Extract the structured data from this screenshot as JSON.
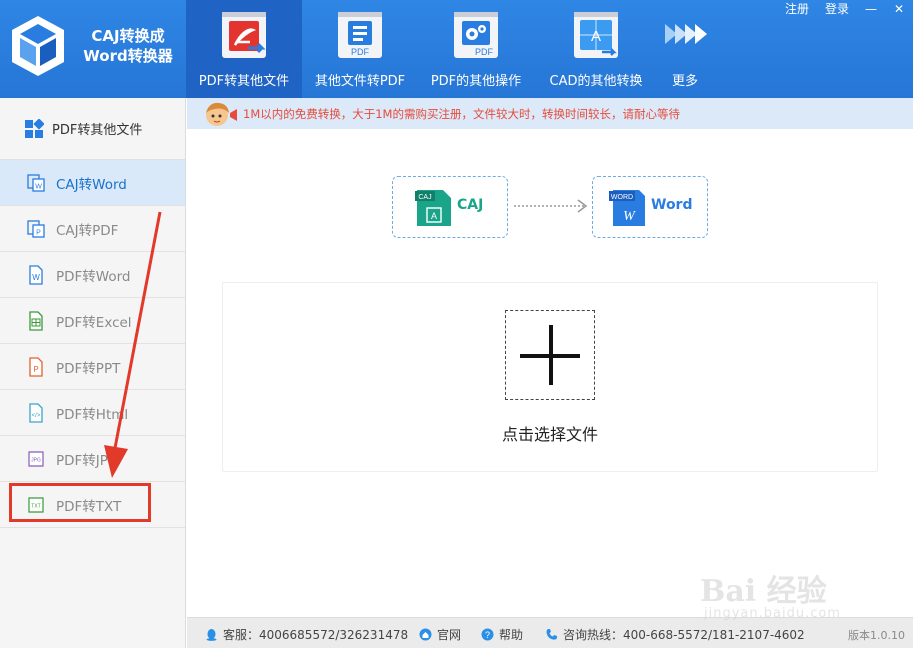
{
  "app": {
    "title_line1": "CAJ转换成",
    "title_line2": "Word转换器"
  },
  "top_links": {
    "register": "注册",
    "login": "登录"
  },
  "nav_tabs": [
    {
      "label": "PDF转其他文件",
      "icon": "pdf-acrobat-icon",
      "active": true
    },
    {
      "label": "其他文件转PDF",
      "icon": "file-to-pdf-icon",
      "active": false
    },
    {
      "label": "PDF的其他操作",
      "icon": "pdf-gear-icon",
      "active": false
    },
    {
      "label": "CAD的其他转换",
      "icon": "cad-icon",
      "active": false
    },
    {
      "label": "更多",
      "icon": "more-arrows-icon",
      "active": false
    }
  ],
  "sidebar": {
    "header": "PDF转其他文件",
    "items": [
      {
        "label": "CAJ转Word",
        "icon": "caj-word-icon",
        "active": true
      },
      {
        "label": "CAJ转PDF",
        "icon": "caj-pdf-icon",
        "active": false
      },
      {
        "label": "PDF转Word",
        "icon": "word-file-icon",
        "active": false
      },
      {
        "label": "PDF转Excel",
        "icon": "excel-file-icon",
        "active": false
      },
      {
        "label": "PDF转PPT",
        "icon": "ppt-file-icon",
        "active": false
      },
      {
        "label": "PDF转Html",
        "icon": "html-file-icon",
        "active": false
      },
      {
        "label": "PDF转JPG",
        "icon": "jpg-file-icon",
        "active": false
      },
      {
        "label": "PDF转TXT",
        "icon": "txt-file-icon",
        "active": false
      }
    ]
  },
  "notice": "1M以内的免费转换，大于1M的需购买注册，文件较大时，转换时间较长，请耐心等待",
  "conversion": {
    "source_badge": "CAJ",
    "source_label": "CAJ",
    "target_badge": "WORD",
    "target_label": "Word"
  },
  "drop_area": {
    "label": "点击选择文件"
  },
  "footer": {
    "service": "客服：4006685572/326231478",
    "website": "官网",
    "help": "帮助",
    "hotline": "咨询热线：400-668-5572/181-2107-4602",
    "version": "版本1.0.10"
  },
  "watermark": {
    "brand": "Bai 经验",
    "url": "jingyan.baidu.com"
  },
  "colors": {
    "header_blue": "#2a7de0",
    "active_tab": "#1f63c4",
    "notice_text": "#e84b3c",
    "annotation_red": "#e23a2a"
  }
}
